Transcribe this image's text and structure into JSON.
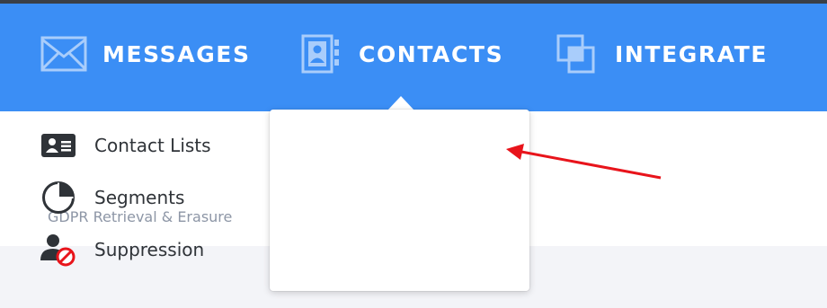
{
  "nav": {
    "items": [
      {
        "label": "MESSAGES",
        "icon": "envelope-icon"
      },
      {
        "label": "CONTACTS",
        "icon": "address-book-icon"
      },
      {
        "label": "INTEGRATE",
        "icon": "overlapping-squares-icon"
      }
    ],
    "active": "CONTACTS"
  },
  "content": {
    "gdpr_link": "GDPR Retrieval & Erasure"
  },
  "dropdown": {
    "items": [
      {
        "label": "Contact Lists",
        "icon": "id-card-icon"
      },
      {
        "label": "Segments",
        "icon": "pie-chart-icon"
      },
      {
        "label": "Suppression",
        "icon": "user-blocked-icon"
      }
    ]
  },
  "colors": {
    "nav_bg": "#3b8ef5",
    "top_strip": "#3a3f47",
    "arrow": "#e8141b",
    "content_gray": "#f3f4f8",
    "gdpr_text": "#8d96a6"
  }
}
